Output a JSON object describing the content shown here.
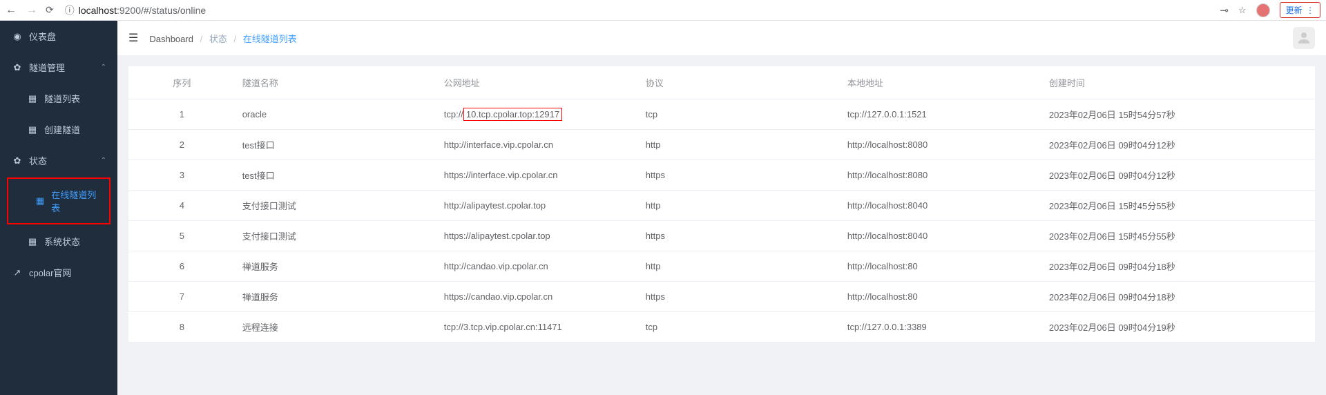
{
  "browser": {
    "url_host": "localhost",
    "url_port": ":9200",
    "url_path": "/#/status/online",
    "update_label": "更新"
  },
  "sidebar": {
    "items": [
      {
        "label": "仪表盘"
      },
      {
        "label": "隧道管理"
      },
      {
        "label": "隧道列表"
      },
      {
        "label": "创建隧道"
      },
      {
        "label": "状态"
      },
      {
        "label": "在线隧道列表"
      },
      {
        "label": "系统状态"
      },
      {
        "label": "cpolar官网"
      }
    ]
  },
  "breadcrumb": {
    "dash": "Dashboard",
    "state": "状态",
    "current": "在线隧道列表"
  },
  "table": {
    "headers": {
      "seq": "序列",
      "name": "隧道名称",
      "pub": "公网地址",
      "proto": "协议",
      "local": "本地地址",
      "time": "创建时间"
    },
    "rows": [
      {
        "seq": "1",
        "name": "oracle",
        "pub_prefix": "tcp://",
        "pub_highlight": "10.tcp.cpolar.top:12917",
        "proto": "tcp",
        "local": "tcp://127.0.0.1:1521",
        "time": "2023年02月06日 15时54分57秒"
      },
      {
        "seq": "2",
        "name": "test接口",
        "pub": "http://interface.vip.cpolar.cn",
        "proto": "http",
        "local": "http://localhost:8080",
        "time": "2023年02月06日 09时04分12秒"
      },
      {
        "seq": "3",
        "name": "test接口",
        "pub": "https://interface.vip.cpolar.cn",
        "proto": "https",
        "local": "http://localhost:8080",
        "time": "2023年02月06日 09时04分12秒"
      },
      {
        "seq": "4",
        "name": "支付接口测试",
        "pub": "http://alipaytest.cpolar.top",
        "proto": "http",
        "local": "http://localhost:8040",
        "time": "2023年02月06日 15时45分55秒"
      },
      {
        "seq": "5",
        "name": "支付接口测试",
        "pub": "https://alipaytest.cpolar.top",
        "proto": "https",
        "local": "http://localhost:8040",
        "time": "2023年02月06日 15时45分55秒"
      },
      {
        "seq": "6",
        "name": "禅道服务",
        "pub": "http://candao.vip.cpolar.cn",
        "proto": "http",
        "local": "http://localhost:80",
        "time": "2023年02月06日 09时04分18秒"
      },
      {
        "seq": "7",
        "name": "禅道服务",
        "pub": "https://candao.vip.cpolar.cn",
        "proto": "https",
        "local": "http://localhost:80",
        "time": "2023年02月06日 09时04分18秒"
      },
      {
        "seq": "8",
        "name": "远程连接",
        "pub": "tcp://3.tcp.vip.cpolar.cn:11471",
        "proto": "tcp",
        "local": "tcp://127.0.0.1:3389",
        "time": "2023年02月06日 09时04分19秒"
      }
    ]
  }
}
